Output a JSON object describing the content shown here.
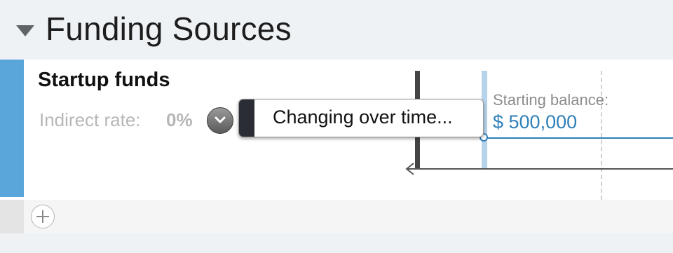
{
  "section": {
    "title": "Funding Sources"
  },
  "fund": {
    "name": "Startup funds",
    "indirect_rate_label": "Indirect rate:",
    "indirect_rate_value": "0%"
  },
  "menu": {
    "changing_over_time_label": "Changing over time..."
  },
  "timeline": {
    "starting_balance_label": "Starting balance:",
    "starting_balance_value": "$ 500,000"
  },
  "colors": {
    "fund_color": "#5aa5d9",
    "balance_line": "#2f7fb8"
  },
  "icons": {
    "disclosure": "triangle-down-icon",
    "dropdown": "chevron-down-icon",
    "add": "plus-icon",
    "axis": "arrow-left-icon"
  }
}
